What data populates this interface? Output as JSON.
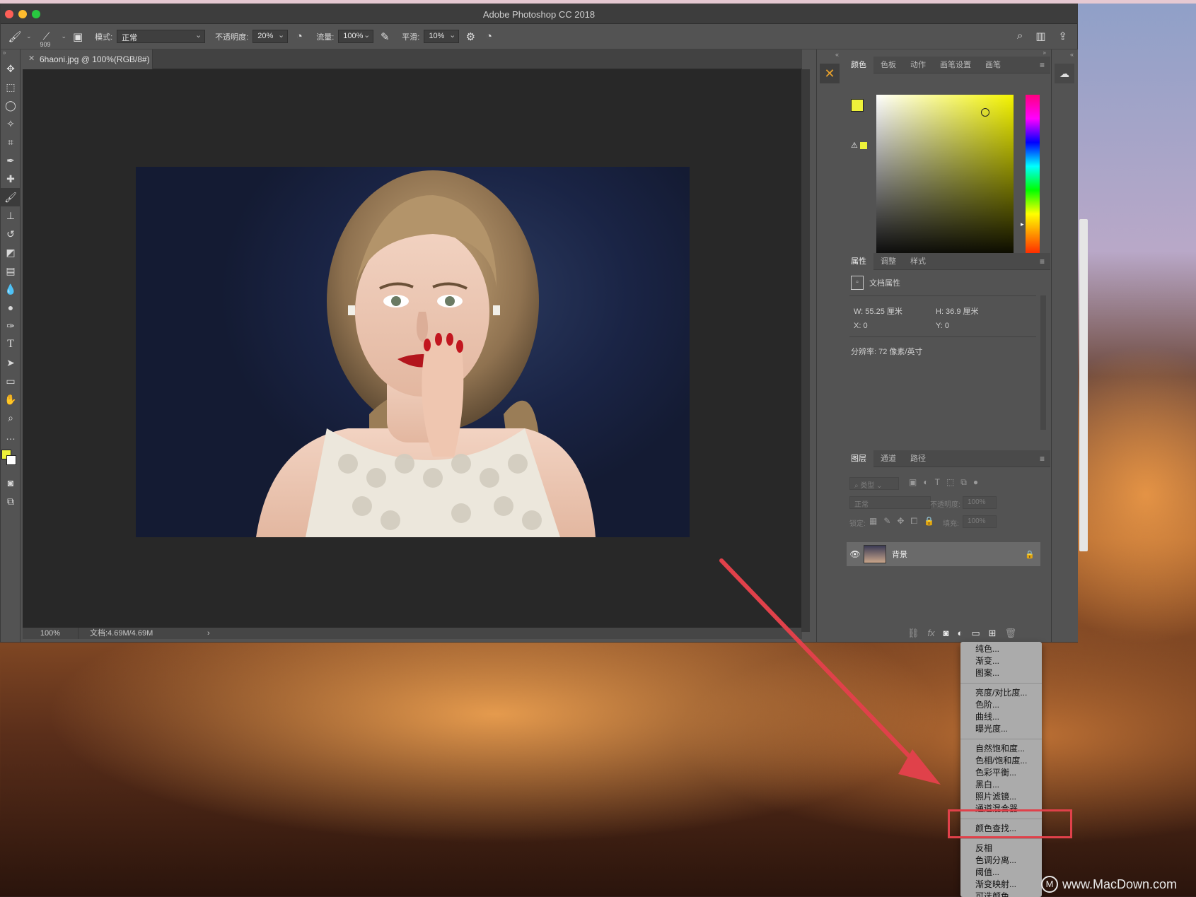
{
  "window": {
    "title": "Adobe Photoshop CC 2018"
  },
  "options": {
    "brush_size": "909",
    "mode_label": "模式:",
    "mode_value": "正常",
    "opacity_label": "不透明度:",
    "opacity_value": "20%",
    "flow_label": "流量:",
    "flow_value": "100%",
    "smooth_label": "平滑:",
    "smooth_value": "10%"
  },
  "document": {
    "tab_title": "6haoni.jpg @ 100%(RGB/8#)",
    "zoom": "100%",
    "doc_info": "文档:4.69M/4.69M"
  },
  "color_panel": {
    "tabs": [
      "颜色",
      "色板",
      "动作",
      "画笔设置",
      "画笔"
    ],
    "foreground": "#eef23a",
    "background": "#ffffff"
  },
  "properties_panel": {
    "tabs": [
      "属性",
      "调整",
      "样式"
    ],
    "title": "文档属性",
    "w": "W: 55.25 厘米",
    "h": "H: 36.9 厘米",
    "x": "X: 0",
    "y": "Y: 0",
    "resolution": "分辨率: 72 像素/英寸"
  },
  "layers_panel": {
    "tabs": [
      "图层",
      "通道",
      "路径"
    ],
    "filter_label": "类型",
    "blend_mode": "正常",
    "opacity_label": "不透明度:",
    "opacity_value": "100%",
    "lock_label": "锁定:",
    "fill_label": "填充:",
    "fill_value": "100%",
    "layer_name": "背景"
  },
  "adjustment_menu": {
    "groups": [
      [
        "纯色...",
        "渐变...",
        "图案..."
      ],
      [
        "亮度/对比度...",
        "色阶...",
        "曲线...",
        "曝光度..."
      ],
      [
        "自然饱和度...",
        "色相/饱和度...",
        "色彩平衡...",
        "黑白...",
        "照片滤镜...",
        "通道混合器..."
      ],
      [
        "颜色查找..."
      ],
      [
        "反相",
        "色调分离...",
        "阈值...",
        "渐变映射...",
        "可选颜色..."
      ]
    ],
    "highlighted": "颜色查找..."
  },
  "watermark": "www.MacDown.com",
  "colors": {
    "annotation": "#e0414a",
    "photoshop_bg": "#535353"
  }
}
